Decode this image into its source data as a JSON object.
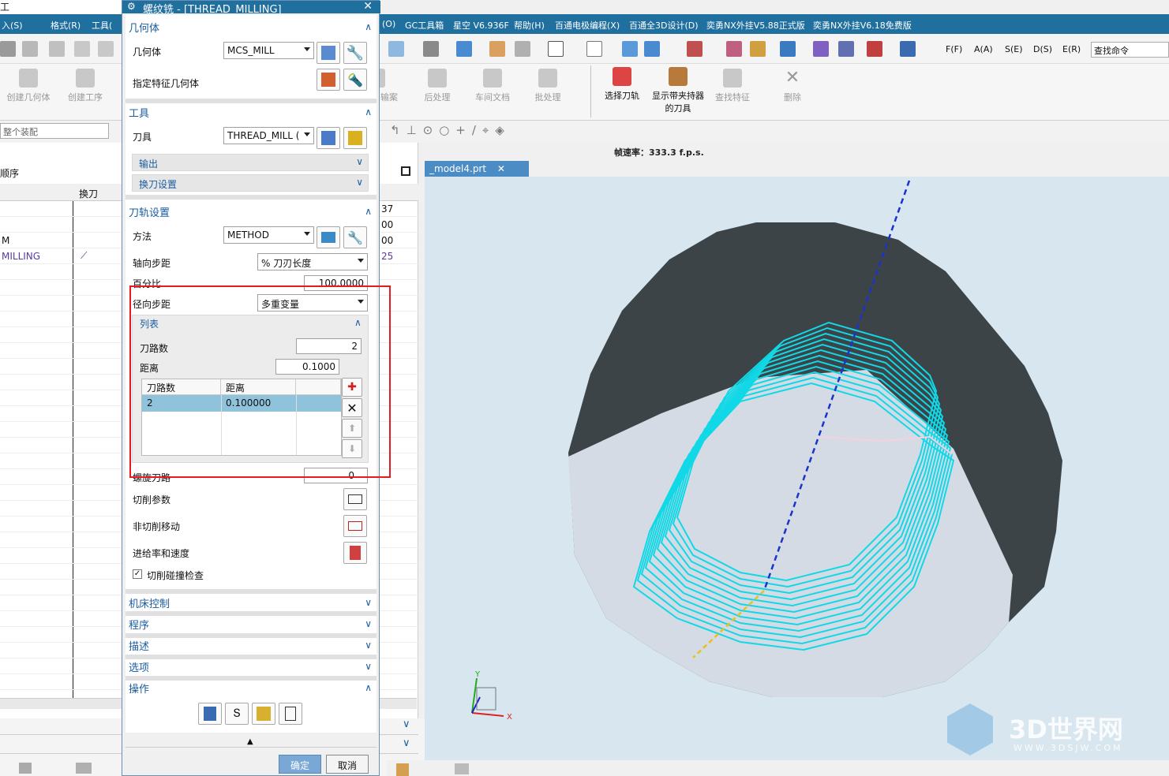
{
  "menubar": {
    "left_items": [
      "工",
      "入(S)",
      "格式(R)",
      "工具("
    ],
    "right_items": [
      "(O)",
      "GC工具箱",
      "星空 V6.936F",
      "帮助(H)",
      "百通电极编程(X)",
      "百通全3D设计(D)",
      "奕勇NX外挂V5.88正式版",
      "奕勇NX外挂V6.18免费版"
    ]
  },
  "toolbar": {
    "left_buttons": [
      "创建几何体",
      "创建工序"
    ],
    "right_buttons": [
      "输案",
      "后处理",
      "车间文档",
      "批处理",
      "选择刀轨",
      "显示带夹持器的刀具",
      "查找特征",
      "删除"
    ],
    "filters": [
      "F(F)",
      "A(A)",
      "S(E)",
      "D(S)",
      "E(R)"
    ],
    "search_placeholder": "查找命令",
    "assembly_select": "整个装配"
  },
  "navigator": {
    "title": "顺序",
    "col_header": "换刀",
    "rows": [
      "",
      "",
      "M",
      "MILLING"
    ],
    "right_values": [
      "37",
      "00",
      "00",
      "25"
    ]
  },
  "fps": "帧速率：333.3 f.p.s.",
  "viewport": {
    "tab_label": "_model4.prt",
    "axis_x": "X",
    "axis_y": "Y"
  },
  "watermark": {
    "main": "3D世界网",
    "sub": "WWW.3DSJW.COM"
  },
  "dialog": {
    "title": "螺纹铣 - [THREAD_MILLING]",
    "geometry": {
      "header": "几何体",
      "geometry_label": "几何体",
      "geometry_value": "MCS_MILL",
      "feature_label": "指定特征几何体"
    },
    "tool": {
      "header": "工具",
      "tool_label": "刀具",
      "tool_value": "THREAD_MILL (",
      "output": "输出",
      "change": "换刀设置"
    },
    "path": {
      "header": "刀轨设置",
      "method_label": "方法",
      "method_value": "METHOD",
      "axial_label": "轴向步距",
      "axial_value": "% 刀刃长度",
      "percent_label": "百分比",
      "percent_value": "100.0000",
      "radial_label": "径向步距",
      "radial_value": "多重变量",
      "list_header": "列表",
      "passes_label": "刀路数",
      "passes_value": "2",
      "distance_label": "距离",
      "distance_value": "0.1000",
      "table_headers": [
        "刀路数",
        "距离"
      ],
      "table_row": [
        "2",
        "0.100000"
      ],
      "spiral_label": "螺旋刀路",
      "spiral_value": "0",
      "cut_params": "切削参数",
      "non_cut": "非切削移动",
      "feeds": "进给率和速度",
      "collision": "切削碰撞检查"
    },
    "collapsed": [
      "机床控制",
      "程序",
      "描述",
      "选项"
    ],
    "ops_header": "操作",
    "ok": "确定",
    "cancel": "取消"
  }
}
